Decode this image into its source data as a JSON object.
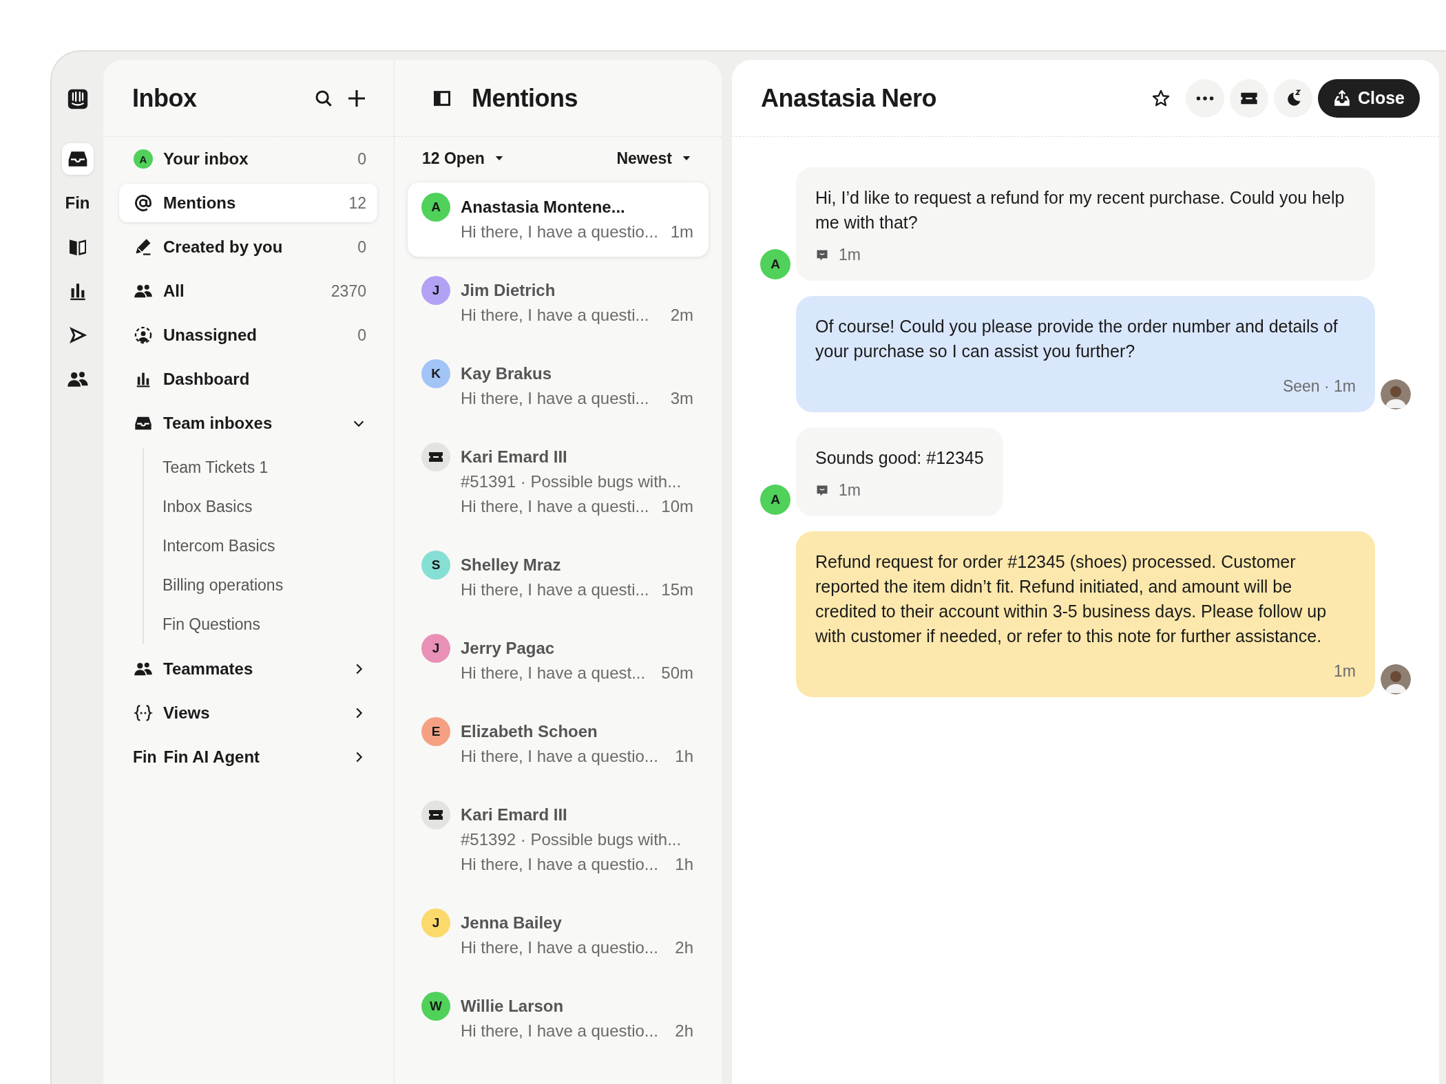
{
  "rail": {
    "items": [
      {
        "selected": true
      },
      {
        "label": "Fin",
        "selected": false
      },
      {
        "selected": false
      },
      {
        "selected": false
      },
      {
        "selected": false
      },
      {
        "selected": false
      }
    ]
  },
  "inbox": {
    "title": "Inbox",
    "items": [
      {
        "label": "Your inbox",
        "count": "0",
        "selected": false,
        "avatar": {
          "initial": "A",
          "color": "#4fd15a"
        }
      },
      {
        "label": "Mentions",
        "count": "12",
        "selected": true
      },
      {
        "label": "Created by you",
        "count": "0",
        "selected": false
      },
      {
        "label": "All",
        "count": "2370",
        "selected": false
      },
      {
        "label": "Unassigned",
        "count": "0",
        "selected": false
      },
      {
        "label": "Dashboard",
        "selected": false
      },
      {
        "label": "Team inboxes",
        "selected": false,
        "expanded": true,
        "children": [
          {
            "label": "Team Tickets 1"
          },
          {
            "label": "Inbox Basics"
          },
          {
            "label": "Intercom Basics"
          },
          {
            "label": "Billing operations"
          },
          {
            "label": "Fin Questions"
          }
        ]
      },
      {
        "label": "Teammates",
        "selected": false,
        "expanded": false
      },
      {
        "label": "Views",
        "selected": false,
        "expanded": false
      },
      {
        "label": "Fin AI Agent",
        "prefix": "Fin",
        "selected": false,
        "expanded": false
      }
    ]
  },
  "list": {
    "title": "Mentions",
    "filters": [
      {
        "label": "12 Open"
      },
      {
        "label": "Newest"
      }
    ],
    "conversations": [
      {
        "kind": "person",
        "name": "Anastasia Montene...",
        "preview": "Hi there, I have a questio...",
        "time": "1m",
        "selected": true,
        "avatar": {
          "initial": "A",
          "color": "#4fd15a"
        }
      },
      {
        "kind": "person",
        "name": "Jim Dietrich",
        "preview": "Hi there, I have a questi...",
        "time": "2m",
        "selected": false,
        "avatar": {
          "initial": "J",
          "color": "#b3a1f5"
        }
      },
      {
        "kind": "person",
        "name": "Kay Brakus",
        "preview": "Hi there, I have a questi...",
        "time": "3m",
        "selected": false,
        "avatar": {
          "initial": "K",
          "color": "#a2c4f6"
        }
      },
      {
        "kind": "ticket",
        "name": "Kari Emard III",
        "ticket": "#51391 · Possible bugs with...",
        "preview": "Hi there, I have a questi...",
        "time": "10m",
        "selected": false
      },
      {
        "kind": "person",
        "name": "Shelley Mraz",
        "preview": "Hi there, I have a questi...",
        "time": "15m",
        "selected": false,
        "avatar": {
          "initial": "S",
          "color": "#86dfd4"
        }
      },
      {
        "kind": "person",
        "name": "Jerry Pagac",
        "preview": "Hi there, I have a quest...",
        "time": "50m",
        "selected": false,
        "avatar": {
          "initial": "J",
          "color": "#e890b6"
        }
      },
      {
        "kind": "person",
        "name": "Elizabeth Schoen",
        "preview": "Hi there, I have a questio...",
        "time": "1h",
        "selected": false,
        "avatar": {
          "initial": "E",
          "color": "#f5a083"
        }
      },
      {
        "kind": "ticket",
        "name": "Kari Emard III",
        "ticket": "#51392 · Possible bugs with...",
        "preview": "Hi there, I have a questio...",
        "time": "1h",
        "selected": false
      },
      {
        "kind": "person",
        "name": "Jenna Bailey",
        "preview": "Hi there, I have a questio...",
        "time": "2h",
        "selected": false,
        "avatar": {
          "initial": "J",
          "color": "#fbd96b"
        }
      },
      {
        "kind": "person",
        "name": "Willie Larson",
        "preview": "Hi there, I have a questio...",
        "time": "2h",
        "selected": false,
        "avatar": {
          "initial": "W",
          "color": "#4fd15a"
        }
      }
    ]
  },
  "conversation": {
    "title": "Anastasia Nero",
    "close_label": "Close",
    "messages": [
      {
        "kind": "customer",
        "text": "Hi, I’d like to request a refund for my recent purchase. Could you help me with that?",
        "time": "1m",
        "avatar": {
          "initial": "A",
          "color": "#4fd15a"
        }
      },
      {
        "kind": "agent",
        "text": "Of course! Could you please provide the order number and details of your purchase so I can assist you further?",
        "time": "Seen · 1m"
      },
      {
        "kind": "customer",
        "text": "Sounds good: #12345",
        "time": "1m",
        "avatar": {
          "initial": "A",
          "color": "#4fd15a"
        }
      },
      {
        "kind": "note",
        "text": "Refund request for order #12345 (shoes) processed. Customer reported the item didn’t fit. Refund initiated, and amount will be credited to their account within 3-5 business days. Please follow up with customer if needed, or refer to this note for further assistance.",
        "time": "1m"
      }
    ]
  }
}
